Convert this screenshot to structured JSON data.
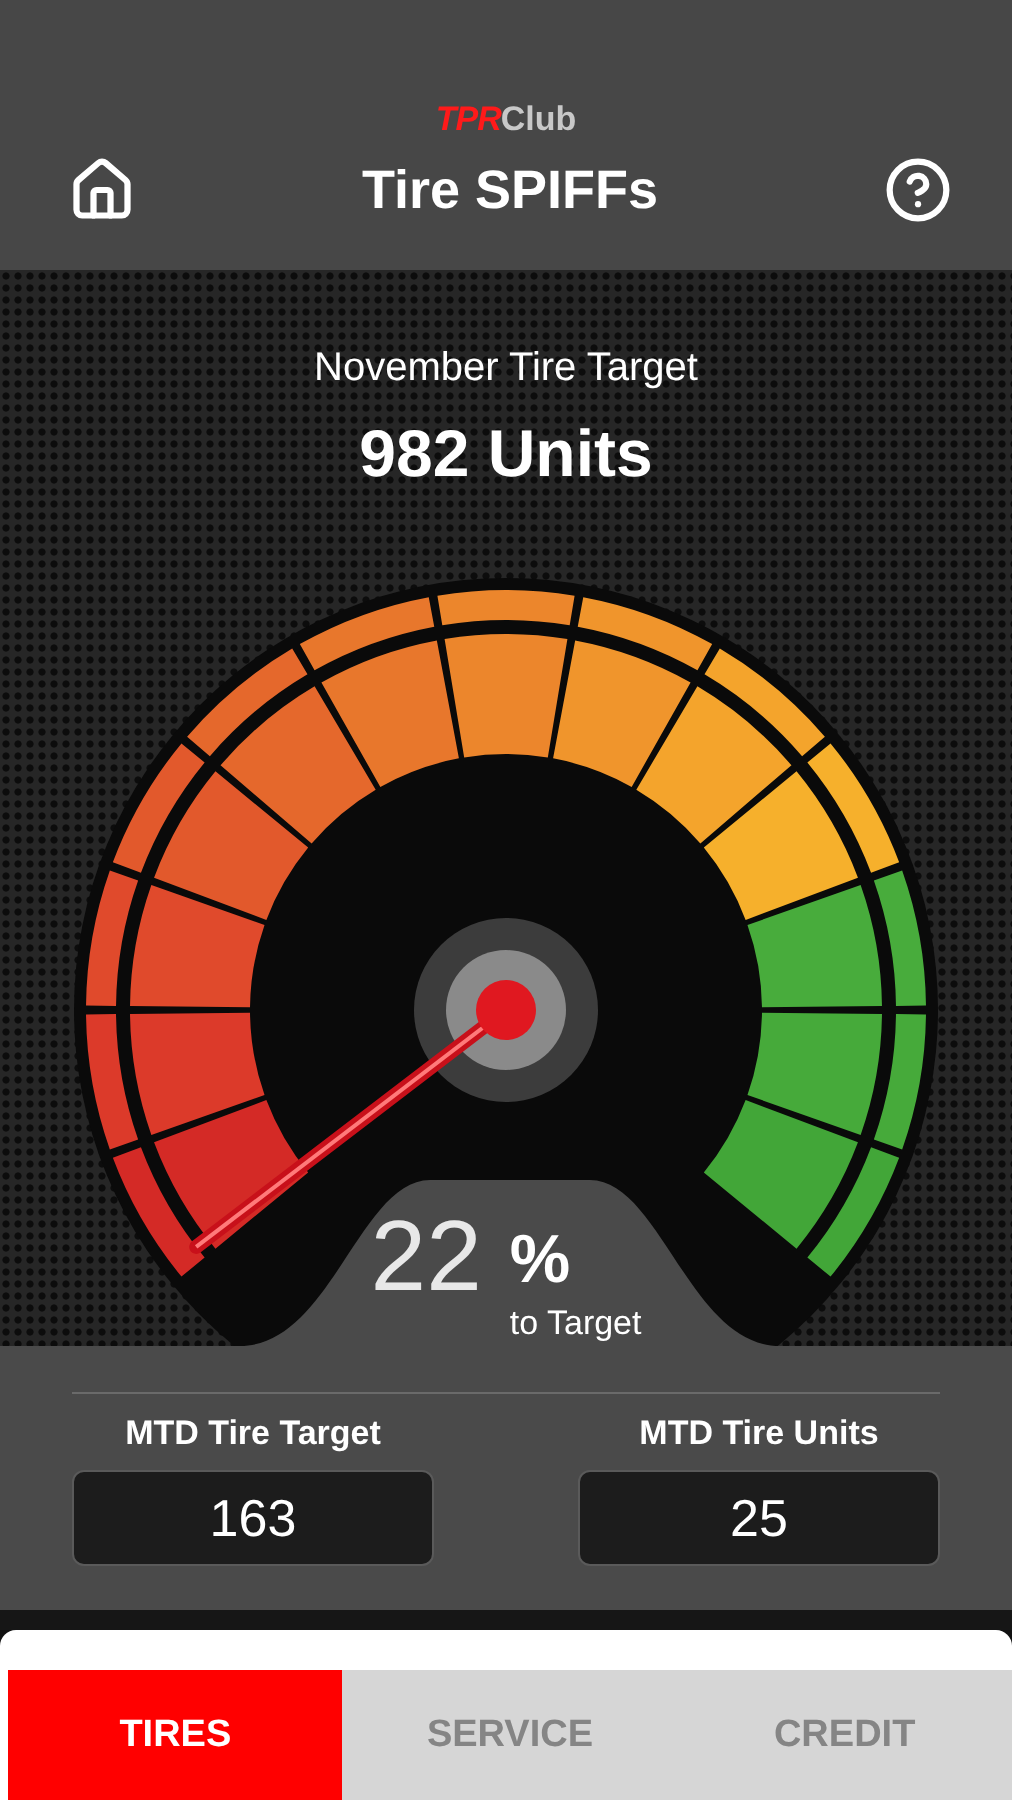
{
  "header": {
    "logo_brand": "TPR",
    "logo_suffix": "Club",
    "title": "Tire SPIFFs"
  },
  "target": {
    "label": "November Tire Target",
    "value": "982 Units"
  },
  "gauge": {
    "percent": "22",
    "percent_sign": "%",
    "caption": "to Target"
  },
  "stats": [
    {
      "label": "MTD Tire Target",
      "value": "163"
    },
    {
      "label": "MTD Tire Units",
      "value": "25"
    }
  ],
  "tabs": [
    {
      "label": "TIRES",
      "selected": true
    },
    {
      "label": "SERVICE",
      "selected": false
    },
    {
      "label": "CREDIT",
      "selected": false
    }
  ]
}
